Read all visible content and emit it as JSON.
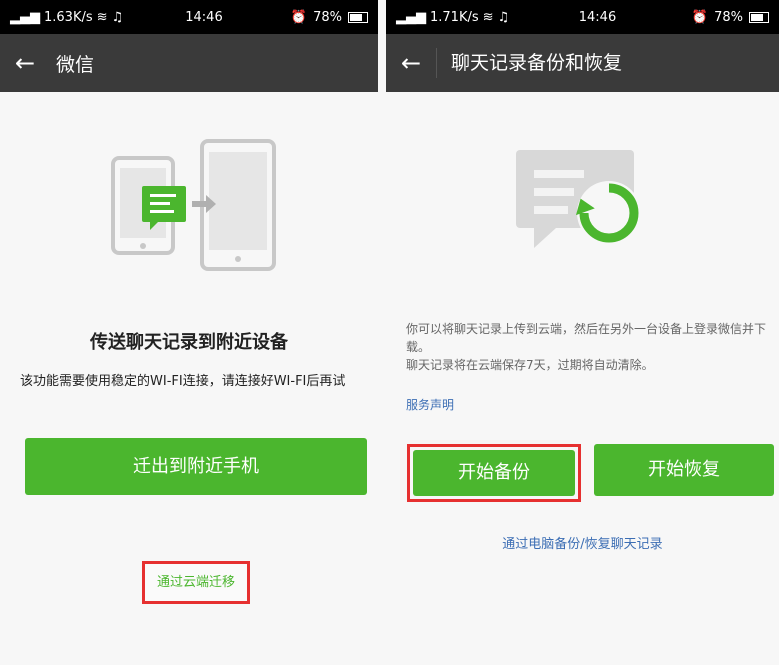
{
  "left": {
    "status": {
      "net": "1.63K/s",
      "time": "14:46",
      "battery": "78%"
    },
    "nav": {
      "title": "微信"
    },
    "heading": "传送聊天记录到附近设备",
    "description": "该功能需要使用稳定的WI-FI连接，请连接好WI-FI后再试",
    "migrate_button": "迁出到附近手机",
    "cloud_link": "通过云端迁移"
  },
  "right": {
    "status": {
      "net": "1.71K/s",
      "time": "14:46",
      "battery": "78%"
    },
    "nav": {
      "title": "聊天记录备份和恢复"
    },
    "description_1": "你可以将聊天记录上传到云端，然后在另外一台设备上登录微信并下载。",
    "description_2": "聊天记录将在云端保存7天，过期将自动清除。",
    "service_link": "服务声明",
    "backup_button": "开始备份",
    "restore_button": "开始恢复",
    "pc_link": "通过电脑备份/恢复聊天记录"
  },
  "colors": {
    "accent_green": "#4bb62e",
    "highlight_red": "#e63030",
    "link_blue": "#3c6eb4"
  }
}
